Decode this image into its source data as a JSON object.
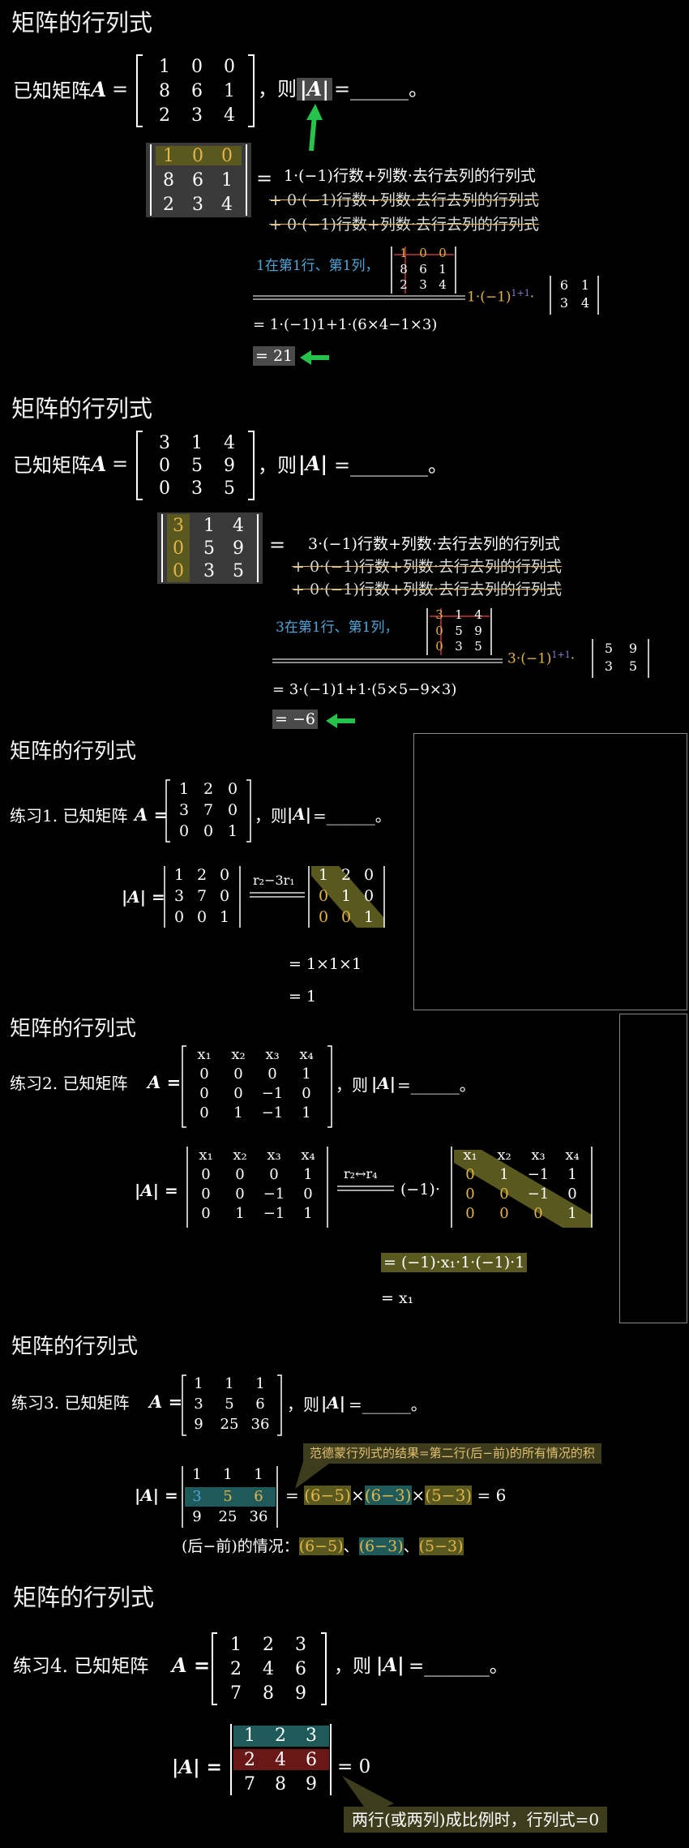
{
  "sections": [
    {
      "title": "矩阵的行列式",
      "question_prefix": "已知矩阵",
      "matrix_name": "A",
      "eq": "=",
      "matrix": [
        [
          "1",
          "0",
          "0"
        ],
        [
          "8",
          "6",
          "1"
        ],
        [
          "2",
          "3",
          "4"
        ]
      ],
      "question_suffix": "，则",
      "det_symbol": "|A|",
      "ending": "=______。",
      "line1": "1·(−1)行数+列数·去行去列的行列式",
      "line2": "+ 0·(−1)行数+列数·去行去列的行列式",
      "line3": "+ 0·(−1)行数+列数·去行去列的行列式",
      "note": "1在第1行、第1列，",
      "minor": [
        [
          "6",
          "1"
        ],
        [
          "3",
          "4"
        ]
      ],
      "step1": "= 1·(−1)1+1·(6×4−1×3)",
      "result": "= 21"
    },
    {
      "title": "矩阵的行列式",
      "question_prefix": "已知矩阵",
      "matrix_name": "A",
      "matrix": [
        [
          "3",
          "1",
          "4"
        ],
        [
          "0",
          "5",
          "9"
        ],
        [
          "0",
          "3",
          "5"
        ]
      ],
      "question_suffix": "，则",
      "det_symbol": "|A|",
      "ending": "=________。",
      "line1": "3·(−1)行数+列数·去行去列的行列式",
      "line2": "+ 0·(−1)行数+列数·去行去列的行列式",
      "line3": "+ 0·(−1)行数+列数·去行去列的行列式",
      "note": "3在第1行、第1列，",
      "minor": [
        [
          "5",
          "9"
        ],
        [
          "3",
          "5"
        ]
      ],
      "step1": "= 3·(−1)1+1·(5×5−9×3)",
      "result": "= −6"
    },
    {
      "title": "矩阵的行列式",
      "question": "练习1. 已知矩阵",
      "matrix_name": "A",
      "matrix": [
        [
          "1",
          "2",
          "0"
        ],
        [
          "3",
          "7",
          "0"
        ],
        [
          "0",
          "0",
          "1"
        ]
      ],
      "question_suffix": "，则",
      "det_symbol": "|A|",
      "ending": "=______。",
      "op": "r₂−3r₁",
      "reduced": [
        [
          "1",
          "2",
          "0"
        ],
        [
          "0",
          "1",
          "0"
        ],
        [
          "0",
          "0",
          "1"
        ]
      ],
      "step1": "= 1×1×1",
      "result": "= 1"
    },
    {
      "title": "矩阵的行列式",
      "question": "练习2. 已知矩阵",
      "matrix_name": "A",
      "header": [
        "x₁",
        "x₂",
        "x₃",
        "x₄"
      ],
      "matrix": [
        [
          "0",
          "0",
          "0",
          "1"
        ],
        [
          "0",
          "0",
          "−1",
          "0"
        ],
        [
          "0",
          "1",
          "−1",
          "1"
        ]
      ],
      "question_suffix": "，则",
      "det_symbol": "|A|",
      "ending": "=______。",
      "op": "r₂↔r₄",
      "factor": "(−1)·",
      "reduced": [
        [
          "0",
          "1",
          "−1",
          "1"
        ],
        [
          "0",
          "0",
          "−1",
          "0"
        ],
        [
          "0",
          "0",
          "0",
          "1"
        ]
      ],
      "step1": "= (−1)·x₁·1·(−1)·1",
      "result": "= x₁"
    },
    {
      "title": "矩阵的行列式",
      "question": "练习3. 已知矩阵",
      "matrix_name": "A",
      "matrix": [
        [
          "1",
          "1",
          "1"
        ],
        [
          "3",
          "5",
          "6"
        ],
        [
          "9",
          "25",
          "36"
        ]
      ],
      "question_suffix": "，则",
      "det_symbol": "|A|",
      "ending": "=______。",
      "callout": "范德蒙行列式的结果=第二行(后−前)的所有情况的积",
      "terms": [
        "(6−5)",
        "(6−3)",
        "(5−3)"
      ],
      "times": "×",
      "equals6": "= 6",
      "cases_label": "(后−前)的情况：",
      "sep": "、"
    },
    {
      "title": "矩阵的行列式",
      "question": "练习4. 已知矩阵",
      "matrix_name": "A",
      "matrix": [
        [
          "1",
          "2",
          "3"
        ],
        [
          "2",
          "4",
          "6"
        ],
        [
          "7",
          "8",
          "9"
        ]
      ],
      "question_suffix": "，则",
      "det_symbol": "|A|",
      "ending": "=_______。",
      "result": "= 0",
      "callout": "两行(或两列)成比例时，行列式=0"
    }
  ]
}
